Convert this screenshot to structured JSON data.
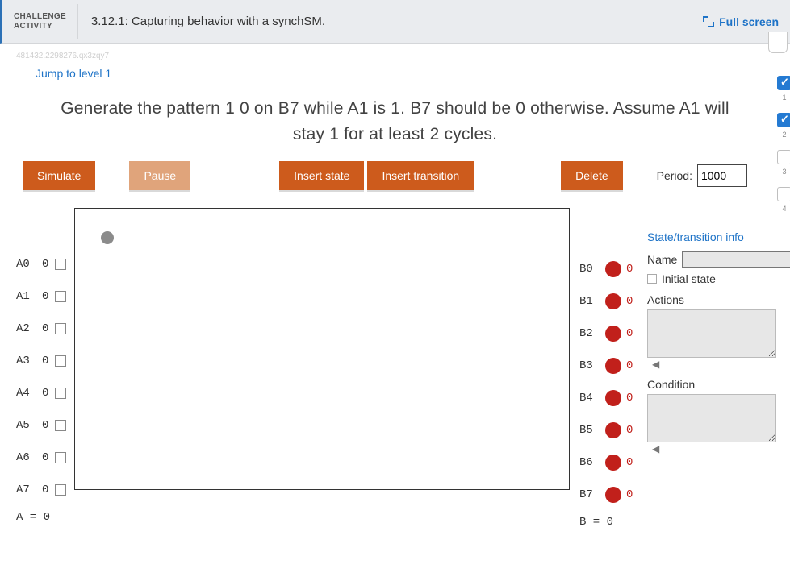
{
  "header": {
    "badge_line1": "CHALLENGE",
    "badge_line2": "ACTIVITY",
    "title": "3.12.1: Capturing behavior with a synchSM.",
    "fullscreen_label": "Full screen"
  },
  "watermark": "481432.2298276.qx3zqy7",
  "jump_label": "Jump to level 1",
  "instructions": "Generate the pattern 1 0 on B7 while A1 is 1. B7 should be 0 otherwise. Assume A1 will stay 1 for at least 2 cycles.",
  "toolbar": {
    "simulate": "Simulate",
    "pause": "Pause",
    "insert_state": "Insert state",
    "insert_transition": "Insert transition",
    "delete": "Delete",
    "period_label": "Period:",
    "period_value": "1000"
  },
  "inputs": {
    "rows": [
      {
        "label": "A0",
        "value": "0"
      },
      {
        "label": "A1",
        "value": "0"
      },
      {
        "label": "A2",
        "value": "0"
      },
      {
        "label": "A3",
        "value": "0"
      },
      {
        "label": "A4",
        "value": "0"
      },
      {
        "label": "A5",
        "value": "0"
      },
      {
        "label": "A6",
        "value": "0"
      },
      {
        "label": "A7",
        "value": "0"
      }
    ],
    "sum": "A = 0"
  },
  "outputs": {
    "rows": [
      {
        "label": "B0",
        "value": "0"
      },
      {
        "label": "B1",
        "value": "0"
      },
      {
        "label": "B2",
        "value": "0"
      },
      {
        "label": "B3",
        "value": "0"
      },
      {
        "label": "B4",
        "value": "0"
      },
      {
        "label": "B5",
        "value": "0"
      },
      {
        "label": "B6",
        "value": "0"
      },
      {
        "label": "B7",
        "value": "0"
      }
    ],
    "sum": "B = 0"
  },
  "side": {
    "title": "State/transition info",
    "name_label": "Name",
    "name_value": "",
    "initial_label": "Initial state",
    "actions_label": "Actions",
    "condition_label": "Condition",
    "arrow_glyph": "◀"
  },
  "progress": {
    "items": [
      "1",
      "2",
      "3",
      "4"
    ]
  }
}
